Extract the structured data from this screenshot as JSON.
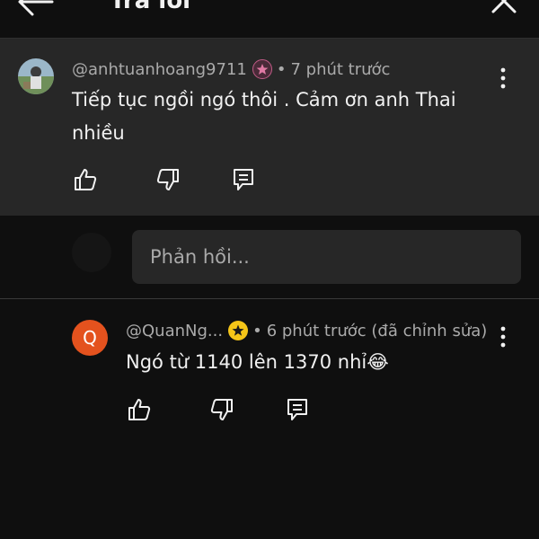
{
  "header": {
    "title": "Trả lời"
  },
  "parent_comment": {
    "username": "@anhtuanhoang9711",
    "time": "7 phút trước",
    "text": "Tiếp tục ngồi ngó thôi . Cảm ơn anh Thai nhiều",
    "badge_color": "#c05b86"
  },
  "reply_box": {
    "placeholder": "Phản hồi..."
  },
  "reply_comment": {
    "avatar_letter": "Q",
    "avatar_color": "#e4521e",
    "username": "@QuanNg...",
    "time": "6 phút trước (đã chỉnh sửa)",
    "text": "Ngó từ 1140 lên 1370 nhỉ😂",
    "badge_color": "#f5c518"
  },
  "colors": {
    "background": "#0f0f0f",
    "highlight_background": "#272727",
    "secondary_text": "#aaaaaa",
    "primary_text": "#f1f1f1"
  },
  "icons": [
    "back-arrow-icon",
    "close-icon",
    "more-vert-icon",
    "like-icon",
    "dislike-icon",
    "reply-icon",
    "star-icon"
  ]
}
